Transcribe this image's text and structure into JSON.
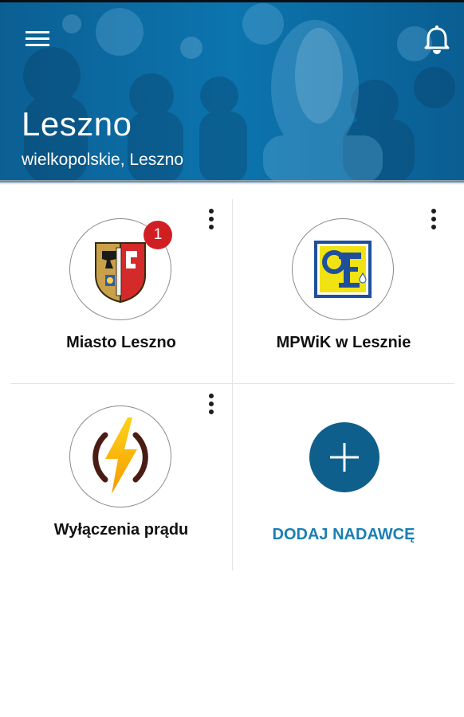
{
  "header": {
    "title": "Leszno",
    "subtitle": "wielkopolskie, Leszno",
    "menu_icon": "hamburger-menu-icon",
    "bell_icon": "bell-icon",
    "accent_color": "#0a6da8"
  },
  "tiles": [
    {
      "name": "Miasto Leszno",
      "badge": "1",
      "logo": "leszno-coat-of-arms",
      "menu_icon": "more-vertical-icon"
    },
    {
      "name": "MPWiK w Lesznie",
      "logo": "mpwik-logo",
      "menu_icon": "more-vertical-icon"
    },
    {
      "name": "Wyłączenia prądu",
      "logo": "lightning-bolt-logo",
      "menu_icon": "more-vertical-icon"
    }
  ],
  "add_sender": {
    "label": "DODAJ NADAWCĘ",
    "icon": "plus-icon",
    "color": "#0f5f8c"
  }
}
